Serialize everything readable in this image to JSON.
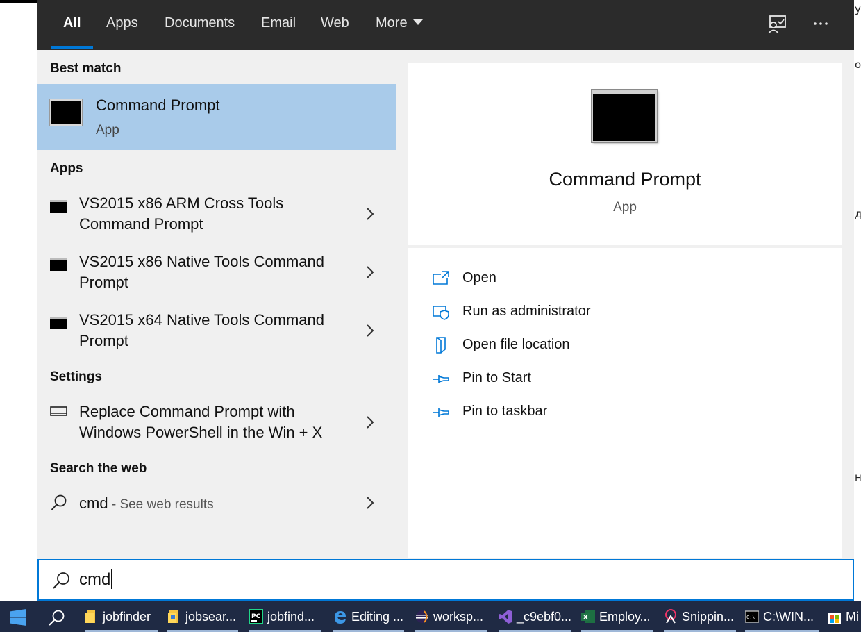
{
  "background": {
    "right_edge_chars": [
      "у",
      "о",
      "д",
      "н"
    ]
  },
  "tabs": [
    {
      "label": "All",
      "active": true
    },
    {
      "label": "Apps"
    },
    {
      "label": "Documents"
    },
    {
      "label": "Email"
    },
    {
      "label": "Web"
    },
    {
      "label": "More"
    }
  ],
  "topbar": {
    "feedback_icon": "feedback-icon",
    "more_icon": "ellipsis-icon"
  },
  "sections": {
    "best_match": "Best match",
    "apps": "Apps",
    "settings": "Settings",
    "search_web": "Search the web"
  },
  "best_match": {
    "title": "Command Prompt",
    "subtitle": "App",
    "icon": "command-prompt-icon"
  },
  "apps": [
    {
      "line1": "VS2015 x86 ARM Cross Tools",
      "line2": "Command Prompt"
    },
    {
      "line1": "VS2015 x86 Native Tools Command",
      "line2": "Prompt"
    },
    {
      "line1": "VS2015 x64 Native Tools Command",
      "line2": "Prompt"
    }
  ],
  "settings": [
    {
      "line1": "Replace Command Prompt with",
      "line2": "Windows PowerShell in the Win + X"
    }
  ],
  "web": {
    "query": "cmd",
    "suffix": " - See web results"
  },
  "preview": {
    "title": "Command Prompt",
    "subtitle": "App"
  },
  "actions": [
    {
      "label": "Open",
      "icon": "open-icon"
    },
    {
      "label": "Run as administrator",
      "icon": "shield-icon"
    },
    {
      "label": "Open file location",
      "icon": "file-location-icon"
    },
    {
      "label": "Pin to Start",
      "icon": "pin-icon"
    },
    {
      "label": "Pin to taskbar",
      "icon": "pin-icon"
    }
  ],
  "search": {
    "value": "cmd"
  },
  "taskbar": {
    "items": [
      {
        "label": "jobfinder",
        "icon": "folder-icon"
      },
      {
        "label": "jobsear...",
        "icon": "folder-icon"
      },
      {
        "label": "jobfind...",
        "icon": "pycharm-icon"
      },
      {
        "label": "Editing ...",
        "icon": "edge-icon"
      },
      {
        "label": "worksp...",
        "icon": "eclipse-icon"
      },
      {
        "label": "_c9ebf0...",
        "icon": "visual-studio-icon"
      },
      {
        "label": "Employ...",
        "icon": "excel-icon"
      },
      {
        "label": "Snippin...",
        "icon": "snipping-icon"
      },
      {
        "label": "C:\\WIN...",
        "icon": "cmd-icon"
      },
      {
        "label": "Mi",
        "icon": "store-icon"
      }
    ]
  },
  "colors": {
    "accent": "#0078d7",
    "selection": "#a9cbea",
    "topbar": "#2b2b2b",
    "taskbar": "#1f2a44"
  }
}
